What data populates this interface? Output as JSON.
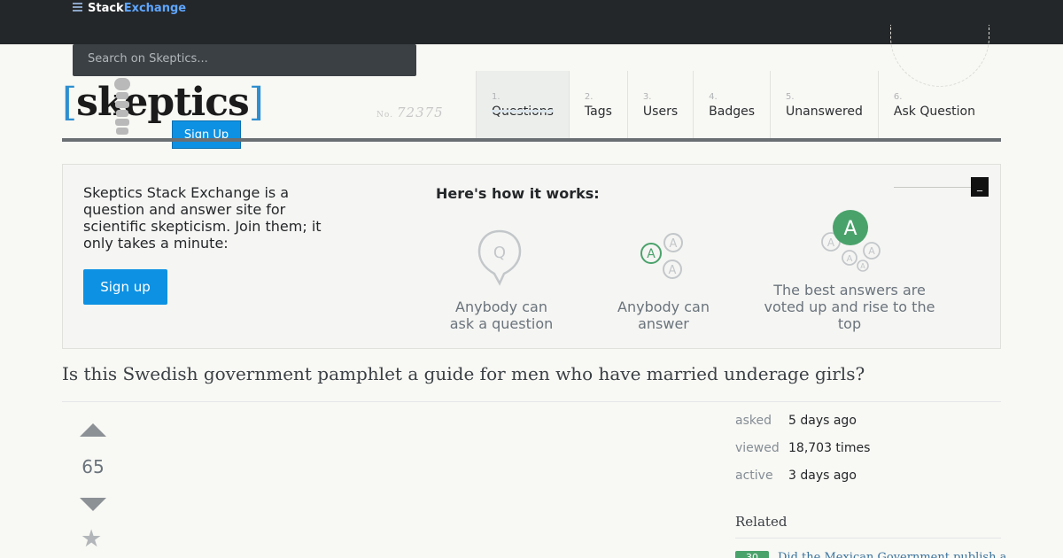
{
  "topbar": {
    "brand_stack": "Stack",
    "brand_exchange": "Exchange"
  },
  "search": {
    "placeholder": "Search on Skeptics..."
  },
  "site": {
    "logo_open": "[",
    "logo_text": "skeptics",
    "logo_close": "]",
    "stamp_no": "No.",
    "stamp_value": "72375",
    "signup_button": "Sign Up"
  },
  "nav": [
    {
      "num": "1.",
      "label": "Questions"
    },
    {
      "num": "2.",
      "label": "Tags"
    },
    {
      "num": "3.",
      "label": "Users"
    },
    {
      "num": "4.",
      "label": "Badges"
    },
    {
      "num": "5.",
      "label": "Unanswered"
    },
    {
      "num": "6.",
      "label": "Ask Question"
    }
  ],
  "welcome": {
    "text": "Skeptics Stack Exchange is a question and answer site for scientific skepticism. Join them; it only takes a minute:",
    "signup": "Sign up",
    "how_title": "Here's how it works:",
    "close": "_",
    "steps": [
      {
        "icon": "question-bubble-icon",
        "text": "Anybody can ask a question"
      },
      {
        "icon": "answer-bubbles-icon",
        "text": "Anybody can answer"
      },
      {
        "icon": "best-answer-icon",
        "text": "The best answers are voted up and rise to the top"
      }
    ],
    "icon_letters": {
      "q": "Q",
      "a": "A"
    }
  },
  "question": {
    "title": "Is this Swedish government pamphlet a guide for men who have married underage girls?",
    "votes": "65"
  },
  "meta": [
    {
      "key": "asked",
      "value": "5 days ago"
    },
    {
      "key": "viewed",
      "value": "18,703 times"
    },
    {
      "key": "active",
      "value": "3 days ago"
    }
  ],
  "related": {
    "title": "Related",
    "items": [
      {
        "score": "30",
        "text": "Did the Mexican Government publish a"
      }
    ]
  },
  "colors": {
    "topbar": "#242729",
    "accent": "#0d91e3",
    "answer_green": "#4aa26b",
    "logo_bracket": "#2e8ecf"
  }
}
